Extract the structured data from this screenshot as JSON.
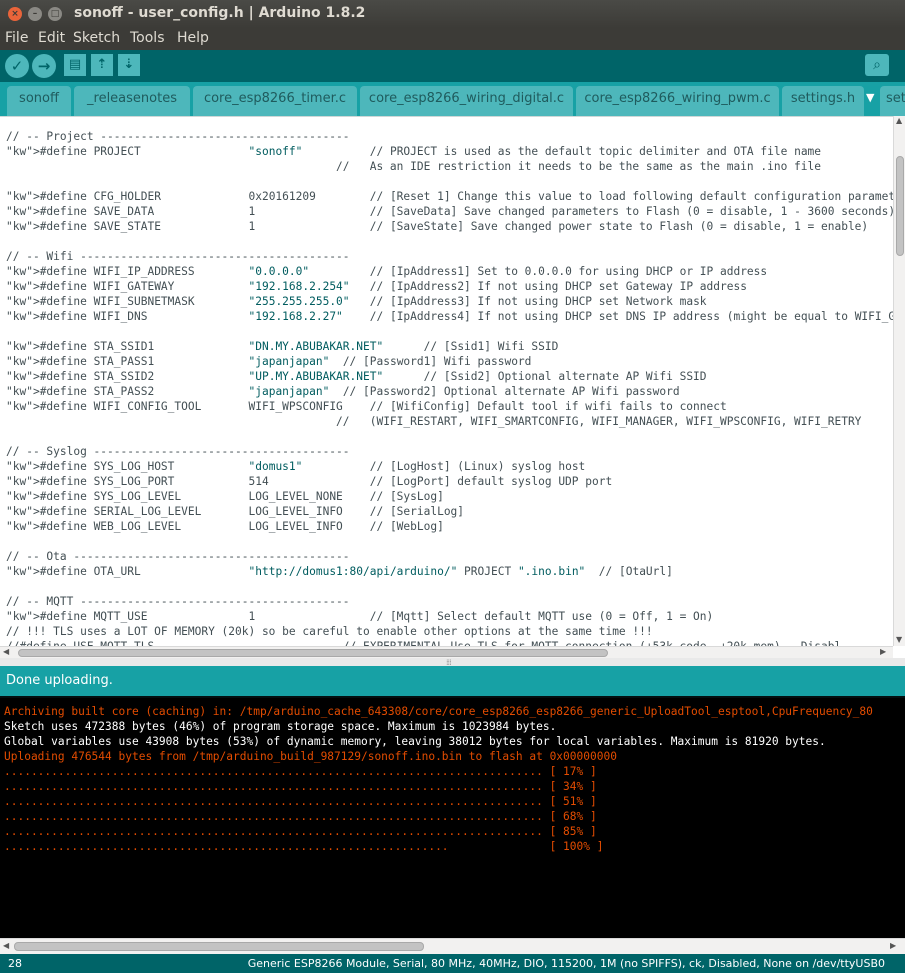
{
  "window": {
    "title": "sonoff - user_config.h | Arduino 1.8.2",
    "close_glyph": "×",
    "min_glyph": "–",
    "max_glyph": "□"
  },
  "menu": [
    "File",
    "Edit",
    "Sketch",
    "Tools",
    "Help"
  ],
  "toolbar": {
    "verify_icon": "check-icon",
    "upload_icon": "arrow-right-icon",
    "new_icon": "new-file-icon",
    "open_icon": "arrow-up-icon",
    "save_icon": "arrow-down-icon",
    "serial_monitor_icon": "magnifier-icon"
  },
  "tabs": [
    {
      "label": "sonoff",
      "active": false
    },
    {
      "label": "_releasenotes",
      "active": false
    },
    {
      "label": "core_esp8266_timer.c",
      "active": false
    },
    {
      "label": "core_esp8266_wiring_digital.c",
      "active": false
    },
    {
      "label": "core_esp8266_wiring_pwm.c",
      "active": false
    },
    {
      "label": "settings.h",
      "active": false
    },
    {
      "label": "set",
      "active": false
    }
  ],
  "code_lines": [
    "// -- Project -------------------------------------",
    "#define PROJECT                \"sonoff\"          // PROJECT is used as the default topic delimiter and OTA file name",
    "                                                 //   As an IDE restriction it needs to be the same as the main .ino file",
    "",
    "#define CFG_HOLDER             0x20161209        // [Reset 1] Change this value to load following default configuration paramet",
    "#define SAVE_DATA              1                 // [SaveData] Save changed parameters to Flash (0 = disable, 1 - 3600 seconds)",
    "#define SAVE_STATE             1                 // [SaveState] Save changed power state to Flash (0 = disable, 1 = enable)",
    "",
    "// -- Wifi ----------------------------------------",
    "#define WIFI_IP_ADDRESS        \"0.0.0.0\"         // [IpAddress1] Set to 0.0.0.0 for using DHCP or IP address",
    "#define WIFI_GATEWAY           \"192.168.2.254\"   // [IpAddress2] If not using DHCP set Gateway IP address",
    "#define WIFI_SUBNETMASK        \"255.255.255.0\"   // [IpAddress3] If not using DHCP set Network mask",
    "#define WIFI_DNS               \"192.168.2.27\"    // [IpAddress4] If not using DHCP set DNS IP address (might be equal to WIFI_G",
    "",
    "#define STA_SSID1              \"DN.MY.ABUBAKAR.NET\"      // [Ssid1] Wifi SSID",
    "#define STA_PASS1              \"japanjapan\"  // [Password1] Wifi password",
    "#define STA_SSID2              \"UP.MY.ABUBAKAR.NET\"      // [Ssid2] Optional alternate AP Wifi SSID",
    "#define STA_PASS2              \"japanjapan\"  // [Password2] Optional alternate AP Wifi password",
    "#define WIFI_CONFIG_TOOL       WIFI_WPSCONFIG    // [WifiConfig] Default tool if wifi fails to connect",
    "                                                 //   (WIFI_RESTART, WIFI_SMARTCONFIG, WIFI_MANAGER, WIFI_WPSCONFIG, WIFI_RETRY",
    "",
    "// -- Syslog --------------------------------------",
    "#define SYS_LOG_HOST           \"domus1\"          // [LogHost] (Linux) syslog host",
    "#define SYS_LOG_PORT           514               // [LogPort] default syslog UDP port",
    "#define SYS_LOG_LEVEL          LOG_LEVEL_NONE    // [SysLog]",
    "#define SERIAL_LOG_LEVEL       LOG_LEVEL_INFO    // [SerialLog]",
    "#define WEB_LOG_LEVEL          LOG_LEVEL_INFO    // [WebLog]",
    "",
    "// -- Ota -----------------------------------------",
    "#define OTA_URL                \"http://domus1:80/api/arduino/\" PROJECT \".ino.bin\"  // [OtaUrl]",
    "",
    "// -- MQTT ----------------------------------------",
    "#define MQTT_USE               1                 // [Mqtt] Select default MQTT use (0 = Off, 1 = On)",
    "// !!! TLS uses a LOT OF MEMORY (20k) so be careful to enable other options at the same time !!!",
    "//#define USE_MQTT_TLS                            // EXPERIMENTAL Use TLS for MQTT connection (+53k code, +20k mem) - Disabl"
  ],
  "status": {
    "message": "Done uploading."
  },
  "console": [
    {
      "text": "Archiving built core (caching) in: /tmp/arduino_cache_643308/core/core_esp8266_esp8266_generic_UploadTool_esptool,CpuFrequency_80",
      "color": "red"
    },
    {
      "text": "Sketch uses 472388 bytes (46%) of program storage space. Maximum is 1023984 bytes.",
      "color": "white"
    },
    {
      "text": "Global variables use 43908 bytes (53%) of dynamic memory, leaving 38012 bytes for local variables. Maximum is 81920 bytes.",
      "color": "white"
    },
    {
      "text": "Uploading 476544 bytes from /tmp/arduino_build_987129/sonoff.ino.bin to flash at 0x00000000",
      "color": "red"
    },
    {
      "text": "................................................................................ [ 17% ]",
      "color": "red"
    },
    {
      "text": "................................................................................ [ 34% ]",
      "color": "red"
    },
    {
      "text": "................................................................................ [ 51% ]",
      "color": "red"
    },
    {
      "text": "................................................................................ [ 68% ]",
      "color": "red"
    },
    {
      "text": "................................................................................ [ 85% ]",
      "color": "red"
    },
    {
      "text": "..................................................................               [ 100% ]",
      "color": "red"
    }
  ],
  "bottom": {
    "line_number": "28",
    "board_info": "Generic ESP8266 Module, Serial, 80 MHz, 40MHz, DIO, 115200, 1M (no SPIFFS), ck, Disabled, None on /dev/ttyUSB0"
  },
  "colors": {
    "teal_dark": "#006468",
    "teal_mid": "#17a1a5",
    "teal_light": "#4db7bb",
    "console_red": "#e34c00"
  }
}
